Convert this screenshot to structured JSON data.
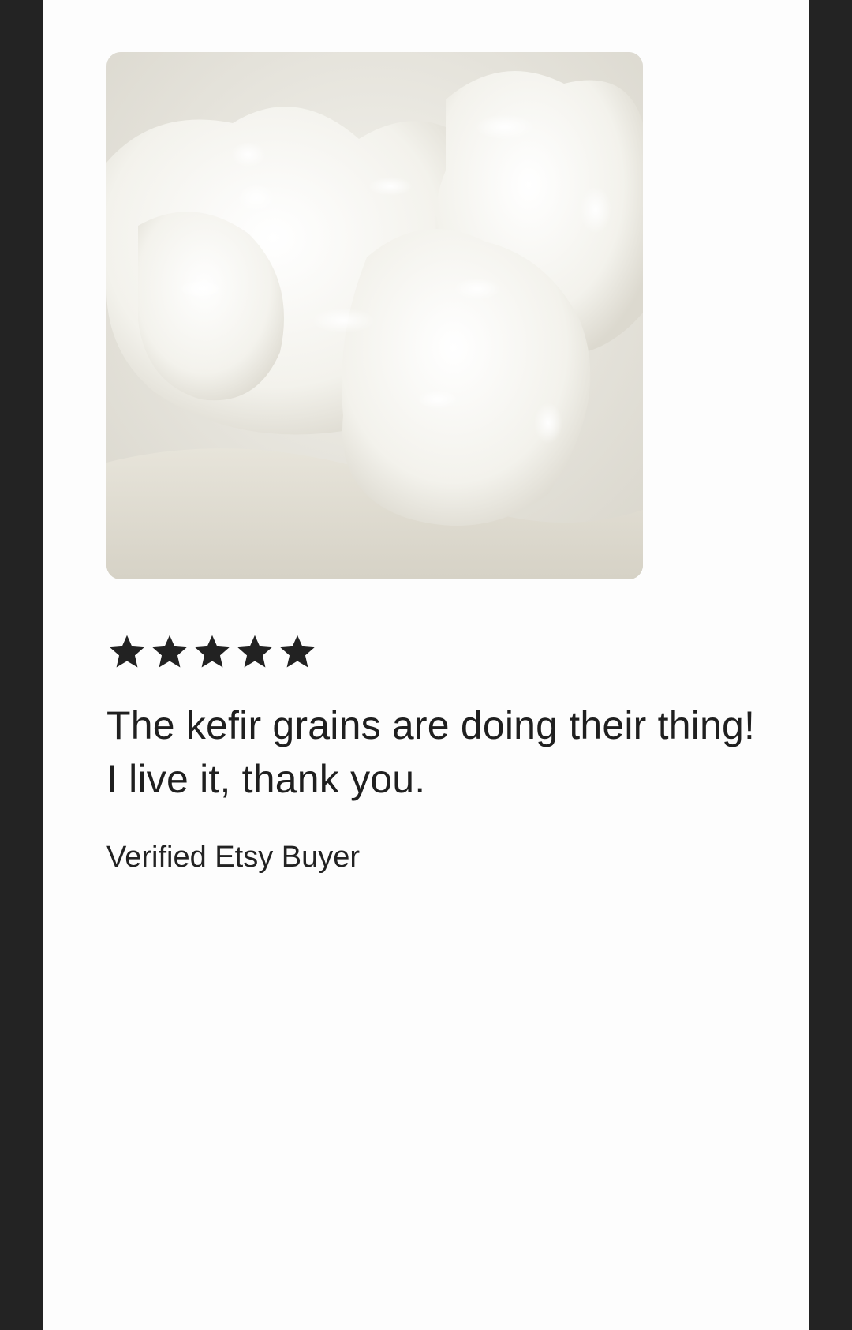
{
  "review": {
    "photo_alt": "Kefir grains photo",
    "rating": 5,
    "rating_max": 5,
    "star_color": "#222222",
    "text": "The kefir grains are doing their thing! I live it, thank you.",
    "reviewer": "Verified Etsy Buyer"
  }
}
